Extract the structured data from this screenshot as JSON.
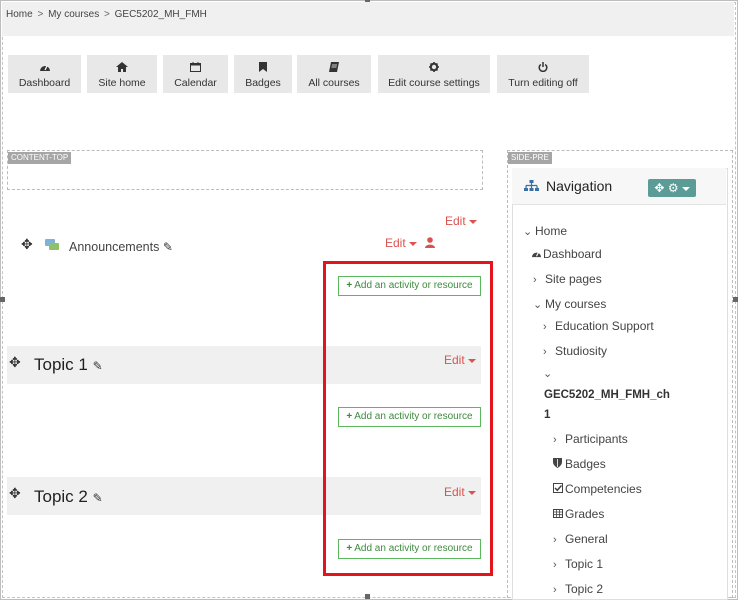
{
  "breadcrumb": {
    "items": [
      "Home",
      "My courses",
      "GEC5202_MH_FMH"
    ],
    "separator": ">"
  },
  "toolbar": [
    {
      "label": "Dashboard",
      "icon": "dashboard-icon"
    },
    {
      "label": "Site home",
      "icon": "home-icon"
    },
    {
      "label": "Calendar",
      "icon": "calendar-icon"
    },
    {
      "label": "Badges",
      "icon": "bookmark-icon"
    },
    {
      "label": "All courses",
      "icon": "book-icon"
    },
    {
      "label": "Edit course settings",
      "icon": "gear-icon"
    },
    {
      "label": "Turn editing off",
      "icon": "power-icon"
    }
  ],
  "regions": {
    "content_top": "CONTENT-TOP",
    "side_pre": "SIDE-PRE"
  },
  "course": {
    "edit_label": "Edit",
    "add_activity_label": "Add an activity or resource",
    "announcements": "Announcements",
    "topics": [
      "Topic 1",
      "Topic 2"
    ]
  },
  "navigation": {
    "title": "Navigation",
    "items": {
      "home": "Home",
      "dashboard": "Dashboard",
      "site_pages": "Site pages",
      "my_courses": "My courses",
      "education_support": "Education Support",
      "studiosity": "Studiosity",
      "course_line1": "GEC5202_MH_FMH_ch",
      "course_line2": "1",
      "participants": "Participants",
      "badges": "Badges",
      "competencies": "Competencies",
      "grades": "Grades",
      "general": "General",
      "topic1": "Topic 1",
      "topic2": "Topic 2"
    }
  },
  "colors": {
    "edit": "#d9534f",
    "add_button": "#5cb85c",
    "highlight": "#e3141b",
    "nav_action": "#5b9c97"
  }
}
